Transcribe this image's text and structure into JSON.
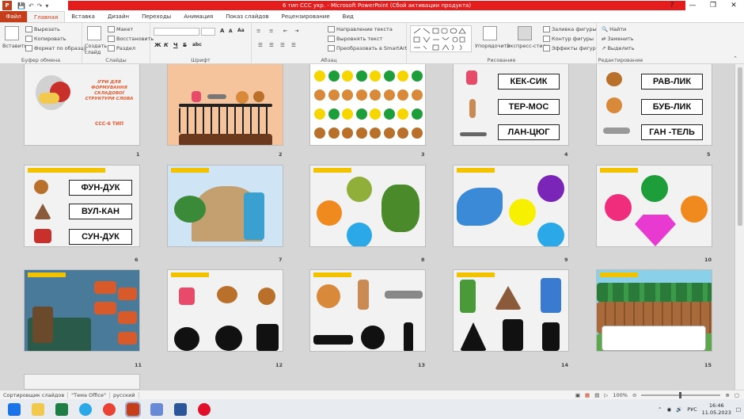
{
  "window": {
    "title": "6 тип ССС укр. - Microsoft PowerPoint (Сбой активации продукта)",
    "app_letter": "P",
    "controls": [
      "?",
      "—",
      "❐",
      "✕"
    ]
  },
  "tabs": [
    {
      "label": "Файл"
    },
    {
      "label": "Главная"
    },
    {
      "label": "Вставка"
    },
    {
      "label": "Дизайн"
    },
    {
      "label": "Переходы"
    },
    {
      "label": "Анимация"
    },
    {
      "label": "Показ слайдов"
    },
    {
      "label": "Рецензирование"
    },
    {
      "label": "Вид"
    }
  ],
  "ribbon": {
    "clipboard": {
      "label": "Буфер обмена",
      "paste": "Вставить",
      "cut": "Вырезать",
      "copy": "Копировать",
      "format": "Формат по образцу"
    },
    "slides": {
      "label": "Слайды",
      "new_slide": "Создать слайд",
      "layout": "Макет",
      "reset": "Восстановить",
      "section": "Раздел"
    },
    "font": {
      "label": "Шрифт",
      "bold": "Ж",
      "italic": "К",
      "underline": "Ч",
      "strike": "S",
      "shadow": "abc",
      "grow": "A",
      "shrink": "A",
      "clear": "Aa"
    },
    "paragraph": {
      "label": "Абзац",
      "direction": "Направление текста",
      "align_text": "Выровнять текст",
      "smartart": "Преобразовать в SmartArt"
    },
    "drawing": {
      "label": "Рисование",
      "arrange": "Упорядочить",
      "quick_styles": "Экспресс-стили",
      "fill": "Заливка фигуры",
      "outline": "Контур фигуры",
      "effects": "Эффекты фигур"
    },
    "editing": {
      "label": "Редактирование",
      "find": "Найти",
      "replace": "Заменить",
      "select": "Выделить"
    }
  },
  "slides": [
    {
      "num": "1",
      "title_text": "ІГРИ ДЛЯ ФОРМУВАННЯ СКЛАДОВОЇ СТРУКТУРИ СЛОВА",
      "subtitle": "ССС-6 ТИП"
    },
    {
      "num": "2"
    },
    {
      "num": "3"
    },
    {
      "num": "4",
      "words": [
        "КЕК-СИК",
        "ТЕР-МОС",
        "ЛАН-ЦЮГ"
      ]
    },
    {
      "num": "5",
      "words": [
        "РАВ-ЛИК",
        "БУБ-ЛИК",
        "ГАН -ТЕЛЬ"
      ]
    },
    {
      "num": "6",
      "words": [
        "ФУН-ДУК",
        "ВУЛ-КАН",
        "СУН-ДУК"
      ]
    },
    {
      "num": "7"
    },
    {
      "num": "8"
    },
    {
      "num": "9"
    },
    {
      "num": "10"
    },
    {
      "num": "11"
    },
    {
      "num": "12"
    },
    {
      "num": "13"
    },
    {
      "num": "14"
    },
    {
      "num": "15"
    }
  ],
  "colors": {
    "accent": "#c43e1c",
    "green": "#1e9e3a",
    "yellow": "#f7d600",
    "orange": "#f08a1f",
    "blue": "#2aa8e8",
    "purple": "#7a25b8",
    "pink": "#f02d7d",
    "olive": "#8fae3a"
  },
  "status": {
    "view": "Сортировщик слайдов",
    "theme": "\"Тема Office\"",
    "language": "русский",
    "zoom": "100%"
  },
  "taskbar": {
    "lang": "РУС",
    "time": "16:46",
    "date": "11.05.2023"
  }
}
